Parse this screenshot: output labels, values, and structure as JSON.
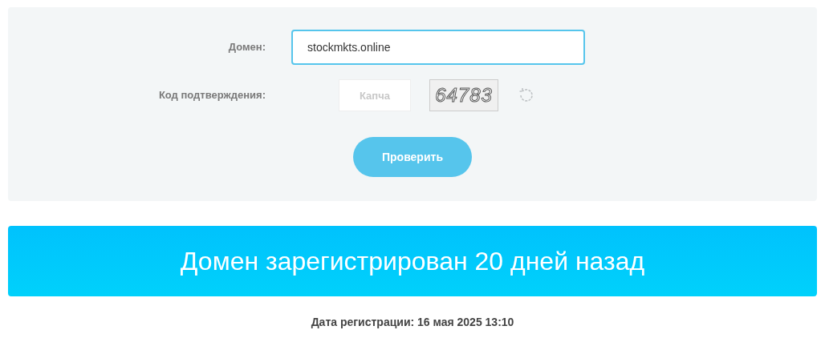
{
  "form": {
    "domain_label": "Домен:",
    "domain_value": "stockmkts.online",
    "domain_focused": true,
    "code_label": "Код подтверждения:",
    "captcha_placeholder": "Капча",
    "captcha_code": "64783",
    "submit": "Проверить"
  },
  "banner": {
    "text": "Домен зарегистрирован 20 дней назад"
  },
  "registration": {
    "text": "**Дата регистрации: 16 мая 2025 13:10**"
  }
}
